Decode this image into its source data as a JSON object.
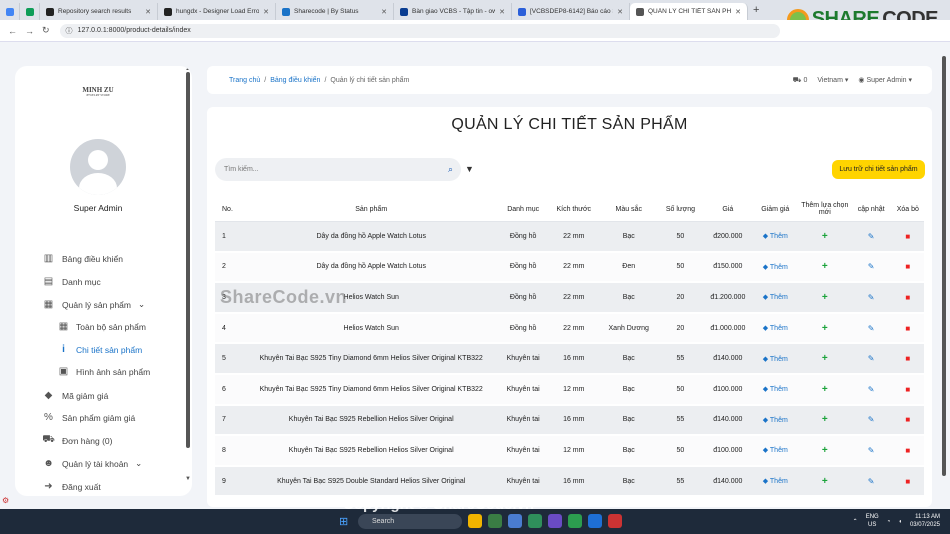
{
  "browser": {
    "tabs": [
      {
        "label": "",
        "color": "#4285f4"
      },
      {
        "label": "",
        "color": "#0f9d58"
      },
      {
        "label": "Repository search results",
        "color": "#222"
      },
      {
        "label": "hungdx - Designer Load Error",
        "color": "#222"
      },
      {
        "label": "Sharecode | By Status",
        "color": "#1a73c8"
      },
      {
        "label": "Bàn giao VCBS - Tập tin - own",
        "color": "#0a3d91"
      },
      {
        "label": "[VCBSDEP8-6142] Báo cáo SEI",
        "color": "#2b5fd9"
      },
      {
        "label": "QUẢN LÝ CHI TIẾT SẢN PHẨM",
        "color": "#555"
      }
    ],
    "url": "127.0.0.1:8000/product-details/index"
  },
  "watermark_logo": {
    "text1": "SHARE",
    "text2": "CODE",
    ".vn": ".vn"
  },
  "sidebar": {
    "brand": "MINH ZU",
    "brand_sub": "JEWELRY STORE",
    "user": "Super Admin",
    "items": [
      {
        "label": "Bảng điều khiển",
        "icon": "columns-icon"
      },
      {
        "label": "Danh mục",
        "icon": "store-icon"
      },
      {
        "label": "Quản lý sản phẩm",
        "icon": "box-icon",
        "caret": "⌄"
      },
      {
        "label": "Toàn bộ sản phẩm",
        "icon": "box-icon"
      },
      {
        "label": "Chi tiết sản phẩm",
        "icon": "info-icon"
      },
      {
        "label": "Hình ảnh sản phẩm",
        "icon": "image-icon"
      },
      {
        "label": "Mã giảm giá",
        "icon": "tag-icon"
      },
      {
        "label": "Sản phẩm giảm giá",
        "icon": "percent-icon"
      },
      {
        "label": "Đơn hàng (0)",
        "icon": "truck-icon"
      },
      {
        "label": "Quản lý tài khoản",
        "icon": "users-icon",
        "caret": "⌄"
      },
      {
        "label": "Đăng xuất",
        "icon": "logout-icon"
      }
    ]
  },
  "header": {
    "breadcrumb": [
      "Trang chủ",
      "Bảng điều khiển",
      "Quản lý chi tiết sản phẩm"
    ],
    "cart_count": "0",
    "language": "Vietnam",
    "user": "Super Admin"
  },
  "main": {
    "title": "QUẢN LÝ CHI TIẾT SẢN PHẨM",
    "search_placeholder": "Tìm kiếm...",
    "store_button": "Lưu trữ chi tiết sản phẩm",
    "columns": [
      "No.",
      "Sản phẩm",
      "Danh mục",
      "Kích thước",
      "Màu sắc",
      "Số lượng",
      "Giá",
      "Giảm giá",
      "Thêm lựa chọn mới",
      "cập nhật",
      "Xóa bỏ"
    ],
    "discount_label": "Thêm",
    "rows": [
      {
        "no": "1",
        "product": "Dây da đồng hồ Apple Watch Lotus",
        "category": "Đồng hồ",
        "size": "22 mm",
        "color": "Bạc",
        "qty": "50",
        "price": "đ200.000"
      },
      {
        "no": "2",
        "product": "Dây da đồng hồ Apple Watch Lotus",
        "category": "Đồng hồ",
        "size": "22 mm",
        "color": "Đen",
        "qty": "50",
        "price": "đ150.000"
      },
      {
        "no": "3",
        "product": "Helios Watch Sun",
        "category": "Đồng hồ",
        "size": "22 mm",
        "color": "Bạc",
        "qty": "20",
        "price": "đ1.200.000"
      },
      {
        "no": "4",
        "product": "Helios Watch Sun",
        "category": "Đồng hồ",
        "size": "22 mm",
        "color": "Xanh Dương",
        "qty": "20",
        "price": "đ1.000.000"
      },
      {
        "no": "5",
        "product": "Khuyên Tai Bạc S925 Tiny Diamond 6mm Helios Silver Original KTB322",
        "category": "Khuyên tai",
        "size": "16 mm",
        "color": "Bạc",
        "qty": "55",
        "price": "đ140.000"
      },
      {
        "no": "6",
        "product": "Khuyên Tai Bạc S925 Tiny Diamond 6mm Helios Silver Original KTB322",
        "category": "Khuyên tai",
        "size": "12 mm",
        "color": "Bạc",
        "qty": "50",
        "price": "đ100.000"
      },
      {
        "no": "7",
        "product": "Khuyên Tai Bạc S925 Rebellion Helios Silver Original",
        "category": "Khuyên tai",
        "size": "16 mm",
        "color": "Bạc",
        "qty": "55",
        "price": "đ140.000"
      },
      {
        "no": "8",
        "product": "Khuyên Tai Bạc S925 Rebellion Helios Silver Original",
        "category": "Khuyên tai",
        "size": "12 mm",
        "color": "Bạc",
        "qty": "50",
        "price": "đ100.000"
      },
      {
        "no": "9",
        "product": "Khuyên Tai Bạc S925 Double Standard Helios Silver Original",
        "category": "Khuyên tai",
        "size": "16 mm",
        "color": "Bạc",
        "qty": "55",
        "price": "đ140.000"
      }
    ]
  },
  "watermarks": {
    "center": "ShareCode.vn",
    "bottom": "Copyright © ShareCode.vn"
  },
  "taskbar": {
    "search": "Search",
    "lang": "ENG",
    "region": "US",
    "time": "11:13 AM",
    "date": "03/07/2025"
  },
  "colors": {
    "accent": "#1a73c8",
    "button": "#ffd400",
    "add": "#1aa33a",
    "delete": "#e22222"
  }
}
